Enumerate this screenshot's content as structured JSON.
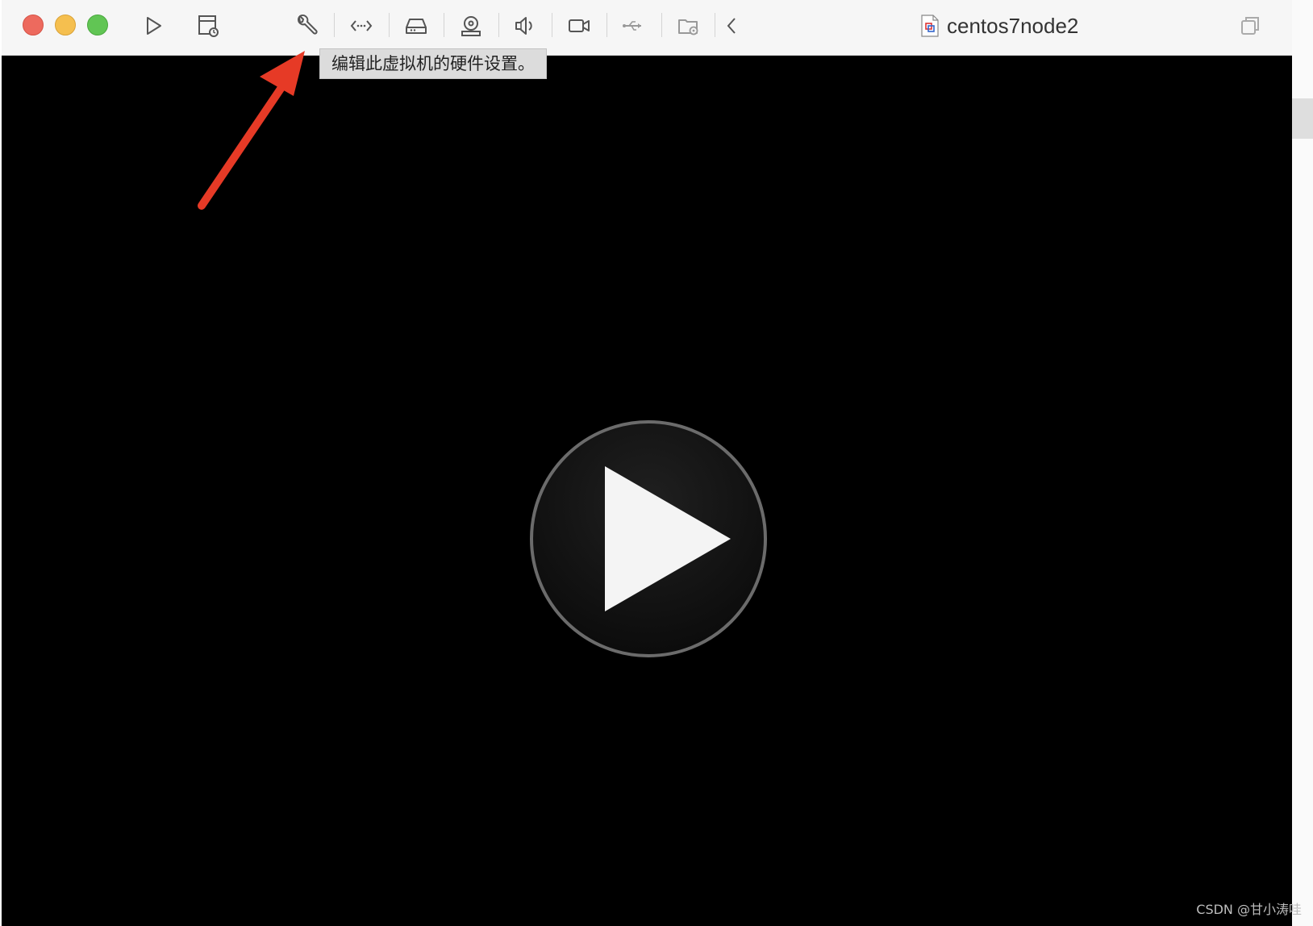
{
  "window": {
    "title": "centos7node2"
  },
  "toolbar": {
    "tooltip": "编辑此虚拟机的硬件设置。",
    "icons": [
      "play-icon",
      "snapshot-icon",
      "wrench-icon",
      "network-icon",
      "disk-icon",
      "camera-disk-icon",
      "speaker-icon",
      "video-camera-icon",
      "usb-icon",
      "shared-folder-icon",
      "chevron-left-icon"
    ]
  },
  "watermark": "CSDN @甘小涛哇",
  "colors": {
    "titlebar": "#f6f6f6",
    "vm_display": "#000000",
    "arrow": "#e63a26",
    "close": "#ed6a5e",
    "minimize": "#f5bf4f",
    "maximize": "#61c554"
  }
}
